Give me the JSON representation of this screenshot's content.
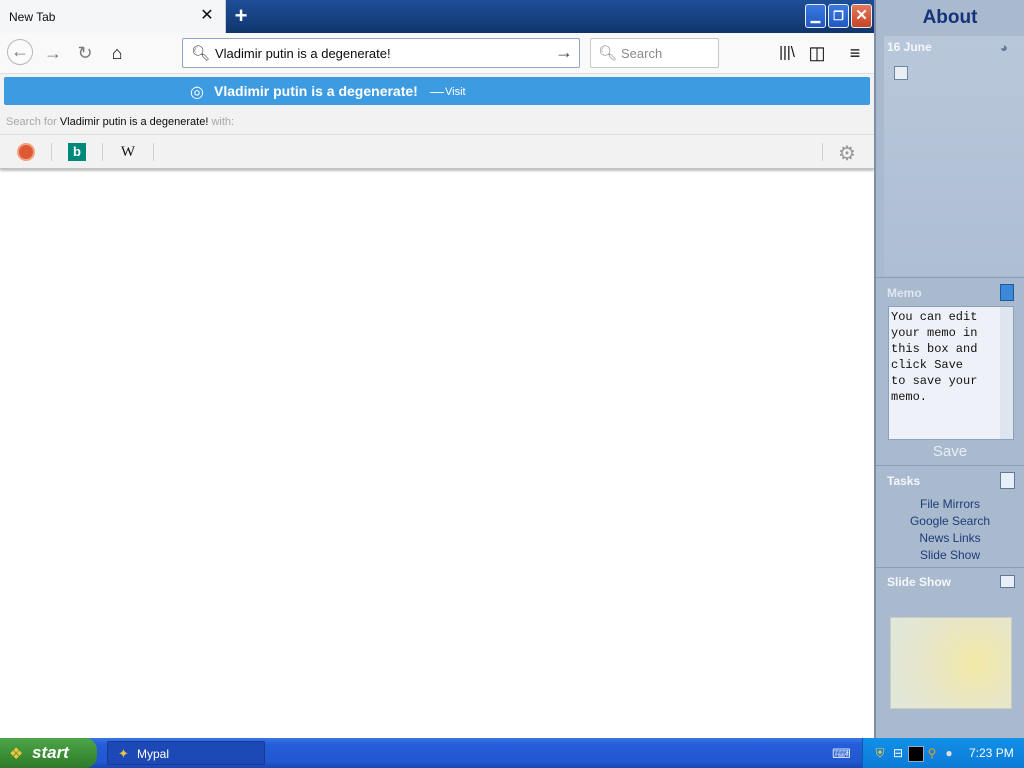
{
  "browser": {
    "tab_title": "New Tab",
    "tab_close": "✕",
    "new_tab": "+",
    "window_controls": {
      "minimize": "▁",
      "maximize": "❐",
      "close": "✕"
    }
  },
  "navbar": {
    "url": "Vladimir putin is a degenerate!",
    "search_placeholder": "Search"
  },
  "popup": {
    "suggestion_text": "Vladimir putin is a degenerate!",
    "suggestion_dash": "—",
    "suggestion_action": "Visit",
    "search_for_prefix": "Search for",
    "search_for_term": "Vladimir putin is a degenerate!",
    "search_for_suffix": "with:",
    "engines": [
      {
        "name": "duckduckgo-icon"
      },
      {
        "name": "bing-icon",
        "glyph": "b"
      },
      {
        "name": "wikipedia-icon",
        "glyph": "W"
      }
    ]
  },
  "sidebar": {
    "title": "About",
    "calendar_date": "16 June",
    "memo_title": "Memo",
    "memo_text": "You can edit\nyour memo in\nthis box and\nclick Save\nto save your\nmemo.",
    "memo_save": "Save",
    "tasks_title": "Tasks",
    "tasks": [
      "File Mirrors",
      "Google Search",
      "News Links",
      "Slide Show"
    ],
    "slideshow_title": "Slide Show"
  },
  "taskbar": {
    "start_label": "start",
    "window_button": "Mypal",
    "clock": "7:23 PM"
  },
  "colors": {
    "accent": "#3d9be2",
    "taskbar": "#245edb",
    "start": "#3a8c34",
    "sidebar": "#a9b9ce"
  }
}
